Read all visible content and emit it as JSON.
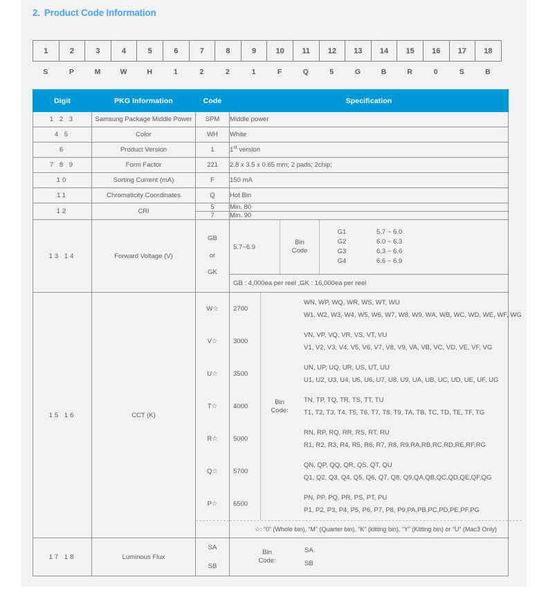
{
  "section": {
    "number": "2.",
    "title": "Product Code Information"
  },
  "code_strip": {
    "positions": [
      "1",
      "2",
      "3",
      "4",
      "5",
      "6",
      "7",
      "8",
      "9",
      "10",
      "11",
      "12",
      "13",
      "14",
      "15",
      "16",
      "17",
      "18"
    ],
    "letters": [
      "S",
      "P",
      "M",
      "W",
      "H",
      "1",
      "2",
      "2",
      "1",
      "F",
      "Q",
      "5",
      "G",
      "B",
      "R",
      "0",
      "S",
      "B"
    ]
  },
  "table": {
    "headers": [
      "Digit",
      "PKG Information",
      "Code",
      "Specification"
    ],
    "rows": [
      {
        "digit": "1  2  3",
        "pkg": "Samsung Package Middle Power",
        "code": "SPM",
        "spec": "Middle power"
      },
      {
        "digit": "4  5",
        "pkg": "Color",
        "code": "WH",
        "spec": "White"
      },
      {
        "digit": "6",
        "pkg": "Product Version",
        "code": "1",
        "spec_pre": "1",
        "spec_sup": "st",
        "spec_post": " version"
      },
      {
        "digit": "7  8  9",
        "pkg": "Form Factor",
        "code": "221",
        "spec": "2.8 x 3.5 x 0.65 mm;   2 pads;   2chip;"
      },
      {
        "digit": "10",
        "pkg": "Sorting Current (mA)",
        "code": "F",
        "spec": "150 mA"
      },
      {
        "digit": "11",
        "pkg": "Chromaticity Coordinates",
        "code": "Q",
        "spec": "Hot Bin"
      }
    ],
    "cri": {
      "digit": "12",
      "pkg": "CRI",
      "entries": [
        {
          "code": "5",
          "spec": "Min. 80"
        },
        {
          "code": "7",
          "spec": "Min. 90"
        }
      ]
    },
    "forward_voltage": {
      "digit": "13  14",
      "pkg": "Forward Voltage (V)",
      "code_lines": [
        "GB",
        "or",
        "GK"
      ],
      "range": "5.7~6.9",
      "bin_label_l1": "Bin",
      "bin_label_l2": "Code",
      "bins": [
        {
          "code": "G1",
          "value": "5.7 ~ 6.0"
        },
        {
          "code": "G2",
          "value": "6.0 ~ 6.3"
        },
        {
          "code": "G3",
          "value": "6.3 ~ 6.6"
        },
        {
          "code": "G4",
          "value": "6.6 ~ 6.9"
        }
      ],
      "note": "GB : 4,000ea per reel ,GK : 16,000ea per reel"
    },
    "cct": {
      "digit": "15  16",
      "pkg": "CCT (K)",
      "bin_label_l1": "Bin",
      "bin_label_l2": "Code:",
      "rows": [
        {
          "code": "W☆",
          "k": "2700",
          "line1": "WN, WP, WQ, WR, WS, WT, WU",
          "line2": "W1, W2, W3, W4, W5, W6, W7, W8, W9, WA, WB, WC, WD, WE, WF, WG"
        },
        {
          "code": "V☆",
          "k": "3000",
          "line1": "VN, VP, VQ, VR, VS, VT, VU",
          "line2": "V1, V2, V3, V4, V5, V6, V7, V8, V9, VA, VB, VC, VD, VE, VF, VG"
        },
        {
          "code": "U☆",
          "k": "3500",
          "line1": "UN, UP, UQ, UR, US, UT, UU",
          "line2": "U1, U2, U3, U4, U5, U6, U7, U8, U9, UA, UB, UC, UD, UE, UF, UG"
        },
        {
          "code": "T☆",
          "k": "4000",
          "line1": "TN, TP, TQ, TR, TS, TT, TU",
          "line2": "T1, T2, T3, T4, T5, T6, T7, T8, T9, TA, TB, TC, TD, TE, TF, TG"
        },
        {
          "code": "R☆",
          "k": "5000",
          "line1": "RN, RP, RQ, RR, RS, RT, RU",
          "line2": "R1, R2, R3, R4, R5, R6, R7, R8, R9,RA,RB,RC,RD,RE,RF,RG"
        },
        {
          "code": "Q☆",
          "k": "5700",
          "line1": "QN, QP, QQ, QR, QS, QT, QU",
          "line2": "Q1, Q2, Q3, Q4, Q5, Q6, Q7, Q8, Q9,QA,QB,QC,QD,QE,QF,QG"
        },
        {
          "code": "P☆",
          "k": "6500",
          "line1": "PN, PP, PQ, PR, PS, PT, PU",
          "line2": "P1, P2, P3, P4, P5, P6, P7, P8, P9,PA,PB,PC,PD,PE,PF,PG"
        }
      ],
      "footnote": "☆: “0” (Whole bin), “M” (Quarter bin), “K” (kitting bin), “Y” (Kitting bin) or “U” (Mac3 Only)"
    },
    "luminous_flux": {
      "digit": "17  18",
      "pkg": "Luminous Flux",
      "codes": [
        "SA",
        "SB"
      ],
      "bin_label_l1": "Bin",
      "bin_label_l2": "Code:",
      "values": [
        "SA",
        "SB"
      ]
    }
  },
  "colors": {
    "title": "#4da3f7",
    "header_bg": "#0099d8",
    "panel_bg": "#f2f2f3",
    "border": "#929497",
    "text": "#58595b"
  }
}
